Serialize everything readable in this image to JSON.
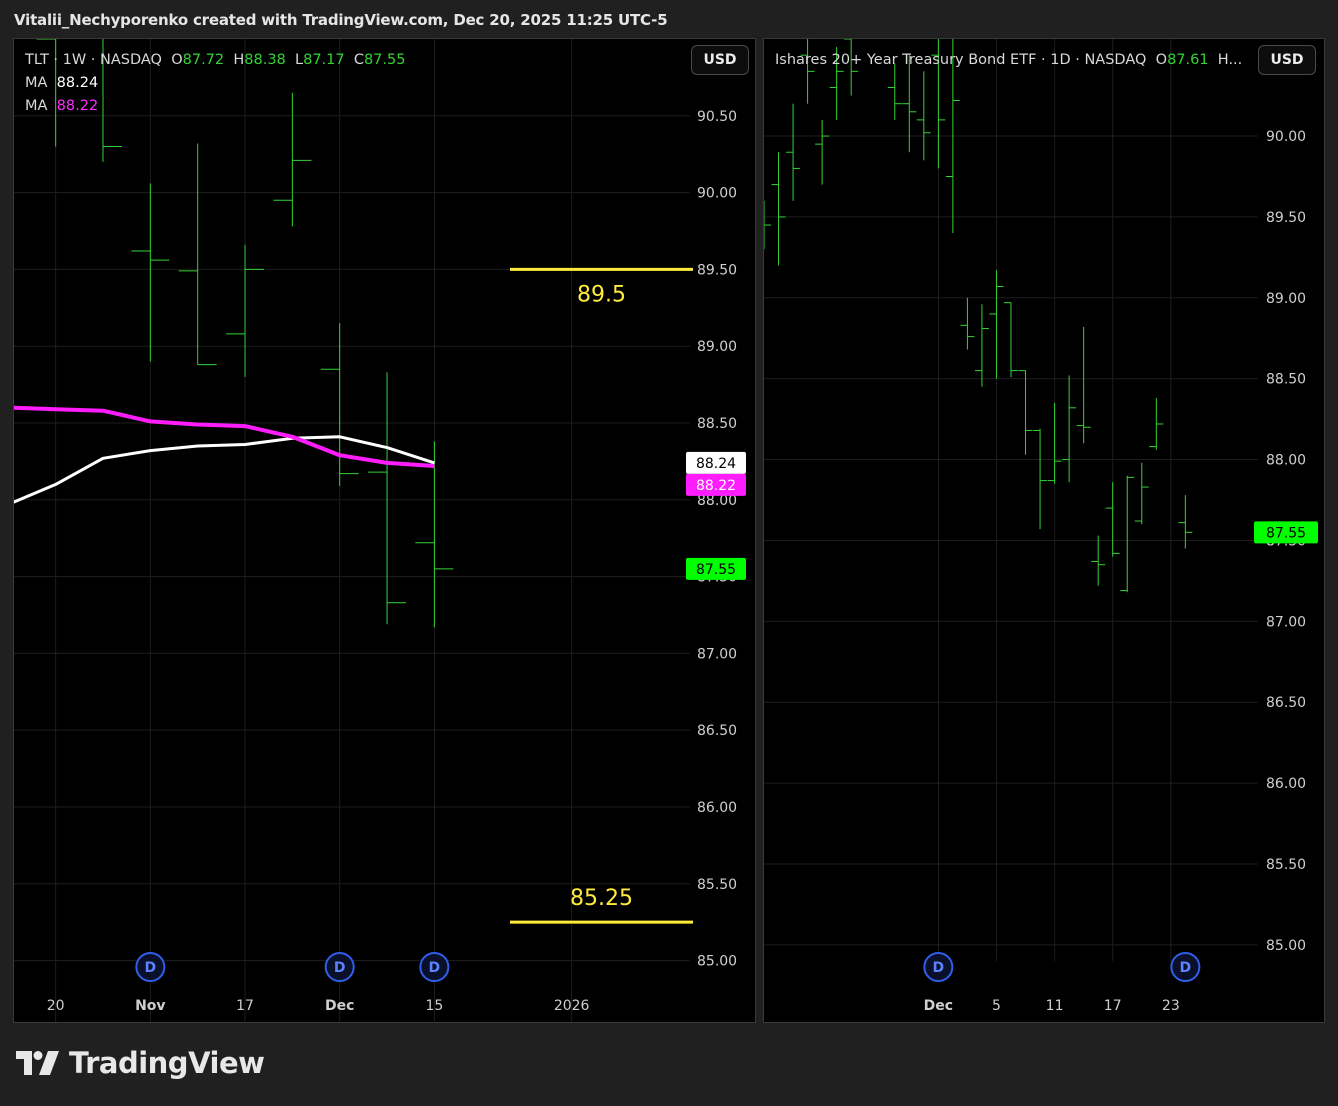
{
  "attribution": "Vitalii_Nechyporenko created with TradingView.com, Dec 20, 2025 11:25 UTC-5",
  "brand": "TradingView",
  "colors": {
    "background": "#000000",
    "frame": "#202020",
    "bar": "#34d334",
    "grid": "#1e1e1e",
    "ma_white": "#ffffff",
    "ma_magenta": "#ff1dff",
    "level_line": "#ffeb3b",
    "price_tag": "#00ff00",
    "dividend_marker": "#2f5fe8"
  },
  "icons": {
    "brand_logo": "tradingview-logo-icon",
    "dividend": "dividend-marker-icon"
  },
  "left_panel": {
    "legend": {
      "symbol": "TLT · 1W · NASDAQ",
      "open_label": "O",
      "open": "87.72",
      "high_label": "H",
      "high": "88.38",
      "low_label": "L",
      "low": "87.17",
      "close_label": "C",
      "close": "87.55",
      "ma1_label": "MA",
      "ma1_value": "88.24",
      "ma2_label": "MA",
      "ma2_value": "88.22"
    },
    "currency_button": "USD"
  },
  "right_panel": {
    "legend": {
      "symbol": "Ishares 20+ Year Treasury Bond ETF · 1D · NASDAQ",
      "open_label": "O",
      "open": "87.61",
      "truncated": "H..."
    },
    "currency_button": "USD"
  },
  "chart_data": [
    {
      "id": "tlt-weekly",
      "type": "ohlc",
      "symbol": "TLT",
      "interval": "1W",
      "exchange": "NASDAQ",
      "ylim": [
        84.6,
        91.0
      ],
      "y_ticks": [
        85.0,
        85.5,
        86.0,
        86.5,
        87.0,
        87.5,
        88.0,
        88.5,
        89.0,
        89.5,
        90.0,
        90.5
      ],
      "x_tick_labels": [
        {
          "label": "20",
          "index": 1
        },
        {
          "label": "Nov",
          "index": 3
        },
        {
          "label": "17",
          "index": 5
        },
        {
          "label": "Dec",
          "index": 7
        },
        {
          "label": "15",
          "index": 9
        },
        {
          "label": "2026",
          "index": 11.9
        }
      ],
      "index_range": [
        0.12,
        14.4
      ],
      "grid": true,
      "bars": [
        {
          "o": 90.3,
          "h": 91.25,
          "l": 89.85,
          "c": 91.15
        },
        {
          "o": 91.0,
          "h": 91.3,
          "l": 90.3,
          "c": 91.2
        },
        {
          "o": 91.3,
          "h": 91.3,
          "l": 90.2,
          "c": 90.3
        },
        {
          "o": 89.62,
          "h": 90.06,
          "l": 88.9,
          "c": 89.56
        },
        {
          "o": 89.49,
          "h": 90.32,
          "l": 88.88,
          "c": 88.88
        },
        {
          "o": 89.08,
          "h": 89.66,
          "l": 88.8,
          "c": 89.5
        },
        {
          "o": 89.95,
          "h": 90.65,
          "l": 89.78,
          "c": 90.21
        },
        {
          "o": 88.85,
          "h": 89.15,
          "l": 88.09,
          "c": 88.17
        },
        {
          "o": 88.18,
          "h": 88.83,
          "l": 87.19,
          "c": 87.33
        },
        {
          "o": 87.72,
          "h": 88.38,
          "l": 87.17,
          "c": 87.55
        }
      ],
      "moving_averages": [
        {
          "label": "MA",
          "color": "#ffffff",
          "value": 88.24,
          "values": [
            87.97,
            88.1,
            88.27,
            88.32,
            88.35,
            88.36,
            88.4,
            88.41,
            88.34,
            88.24
          ]
        },
        {
          "label": "MA",
          "color": "#ff1dff",
          "value": 88.22,
          "values": [
            88.6,
            88.59,
            88.58,
            88.51,
            88.49,
            88.48,
            88.41,
            88.29,
            88.24,
            88.22
          ]
        }
      ],
      "levels": [
        {
          "value": 89.5,
          "label": "89.5"
        },
        {
          "value": 85.25,
          "label": "85.25"
        }
      ],
      "price_tags": [
        {
          "value": 88.24,
          "label": "88.24",
          "bg": "#ffffff",
          "fg": "#000000"
        },
        {
          "value": 88.22,
          "label": "88.22",
          "bg": "#ff1dff",
          "fg": "#ffffff"
        },
        {
          "value": 87.55,
          "label": "87.55",
          "bg": "#00ff00",
          "fg": "#000000"
        }
      ],
      "dividends": [
        3,
        7,
        9
      ],
      "dividend_label": "D"
    },
    {
      "id": "tlt-daily",
      "type": "ohlc",
      "symbol": "Ishares 20+ Year Treasury Bond ETF",
      "interval": "1D",
      "exchange": "NASDAQ",
      "ylim": [
        84.9,
        90.6
      ],
      "y_ticks": [
        85.0,
        85.5,
        86.0,
        86.5,
        87.0,
        87.5,
        88.0,
        88.5,
        89.0,
        89.5,
        90.0
      ],
      "x_tick_labels": [
        {
          "label": "Dec",
          "index": 12
        },
        {
          "label": "5",
          "index": 16
        },
        {
          "label": "11",
          "index": 20
        },
        {
          "label": "17",
          "index": 24
        },
        {
          "label": "23",
          "index": 28
        }
      ],
      "index_range": [
        0,
        34
      ],
      "grid": true,
      "bars": [
        {
          "o": 89.5,
          "h": 89.6,
          "l": 89.3,
          "c": 89.45
        },
        {
          "o": 89.7,
          "h": 89.9,
          "l": 89.2,
          "c": 89.5
        },
        {
          "o": 89.9,
          "h": 90.2,
          "l": 89.6,
          "c": 89.8
        },
        {
          "o": 90.5,
          "h": 90.6,
          "l": 90.2,
          "c": 90.4
        },
        {
          "o": 89.95,
          "h": 90.1,
          "l": 89.7,
          "c": 90.0
        },
        {
          "o": 90.3,
          "h": 90.55,
          "l": 90.1,
          "c": 90.4
        },
        {
          "o": 90.6,
          "h": 90.62,
          "l": 90.25,
          "c": 90.4
        },
        {
          "o": 90.3,
          "h": 90.45,
          "l": 90.1,
          "c": 90.2
        },
        {
          "o": 90.2,
          "h": 90.5,
          "l": 89.9,
          "c": 90.15
        },
        {
          "o": 90.1,
          "h": 90.4,
          "l": 89.85,
          "c": 90.02
        },
        {
          "o": 90.5,
          "h": 90.6,
          "l": 89.8,
          "c": 90.1
        },
        {
          "o": 89.75,
          "h": 90.6,
          "l": 89.4,
          "c": 90.22
        },
        {
          "o": 88.83,
          "h": 89.0,
          "l": 88.68,
          "c": 88.76
        },
        {
          "o": 88.55,
          "h": 88.96,
          "l": 88.45,
          "c": 88.81
        },
        {
          "o": 88.9,
          "h": 89.17,
          "l": 88.5,
          "c": 89.07
        },
        {
          "o": 88.97,
          "h": 88.97,
          "l": 88.51,
          "c": 88.55
        },
        {
          "o": 88.55,
          "h": 88.55,
          "l": 88.03,
          "c": 88.18
        },
        {
          "o": 88.18,
          "h": 88.19,
          "l": 87.57,
          "c": 87.87
        },
        {
          "o": 87.87,
          "h": 88.35,
          "l": 87.85,
          "c": 87.99
        },
        {
          "o": 88.0,
          "h": 88.52,
          "l": 87.86,
          "c": 88.32
        },
        {
          "o": 88.21,
          "h": 88.82,
          "l": 88.1,
          "c": 88.2
        },
        {
          "o": 87.37,
          "h": 87.53,
          "l": 87.22,
          "c": 87.35
        },
        {
          "o": 87.7,
          "h": 87.86,
          "l": 87.4,
          "c": 87.42
        },
        {
          "o": 87.19,
          "h": 87.9,
          "l": 87.18,
          "c": 87.89
        },
        {
          "o": 87.62,
          "h": 87.98,
          "l": 87.6,
          "c": 87.83
        },
        {
          "o": 88.08,
          "h": 88.38,
          "l": 88.06,
          "c": 88.22
        },
        {
          "o": 87.61,
          "h": 87.78,
          "l": 87.45,
          "c": 87.55
        }
      ],
      "bar_indices": [
        0,
        1,
        2,
        3,
        4,
        5,
        6,
        9,
        10,
        11,
        12,
        13,
        14,
        15,
        16,
        17,
        18,
        19,
        20,
        21,
        22,
        23,
        24,
        25,
        26,
        27,
        29
      ],
      "price_tags": [
        {
          "value": 87.55,
          "label": "87.55",
          "bg": "#00ff00",
          "fg": "#000000"
        }
      ],
      "dividends": [
        12,
        29
      ],
      "dividend_label": "D"
    }
  ]
}
